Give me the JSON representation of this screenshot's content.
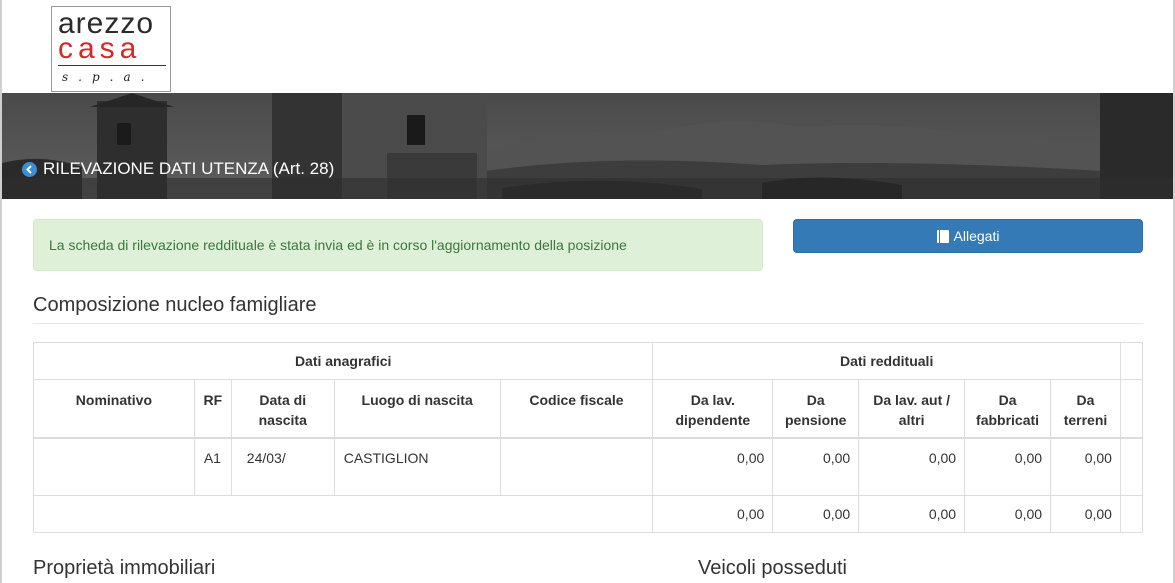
{
  "logo": {
    "line1": "arezzo",
    "line2": "casa",
    "line3": "s.p.a."
  },
  "header": {
    "title": "RILEVAZIONE DATI UTENZA (Art. 28)"
  },
  "alert": {
    "text": "La scheda di rilevazione reddituale è stata invia ed è in corso l'aggiornamento della posizione"
  },
  "buttons": {
    "allegati": "Allegati"
  },
  "sections": {
    "nucleo": "Composizione nucleo famigliare",
    "immobili": "Proprietà immobiliari",
    "veicoli": "Veicoli posseduti"
  },
  "table": {
    "group_headers": {
      "anagrafici": "Dati anagrafici",
      "reddituali": "Dati reddituali"
    },
    "columns": {
      "nominativo": "Nominativo",
      "rf": "RF",
      "data_nascita_1": "Data di",
      "data_nascita_2": "nascita",
      "luogo": "Luogo di nascita",
      "codice": "Codice fiscale",
      "dip_1": "Da lav.",
      "dip_2": "dipendente",
      "pens_1": "Da",
      "pens_2": "pensione",
      "aut_1": "Da lav. aut /",
      "aut_2": "altri",
      "fab_1": "Da",
      "fab_2": "fabbricati",
      "ter_1": "Da",
      "ter_2": "terreni"
    },
    "rows": [
      {
        "nominativo": "",
        "rf": "A1",
        "data": "24/03/",
        "luogo": "CASTIGLION",
        "codice": "",
        "dipendente": "0,00",
        "pensione": "0,00",
        "autonomo": "0,00",
        "fabbricati": "0,00",
        "terreni": "0,00"
      }
    ],
    "totals": {
      "dipendente": "0,00",
      "pensione": "0,00",
      "autonomo": "0,00",
      "fabbricati": "0,00",
      "terreni": "0,00"
    }
  }
}
